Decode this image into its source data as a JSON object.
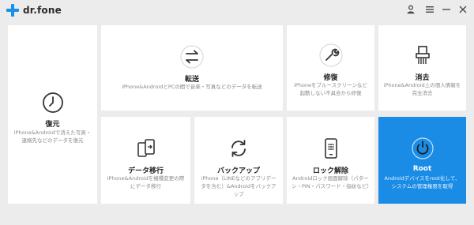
{
  "app": {
    "name": "dr.fone",
    "brand_color": "#1890e8"
  },
  "titlebar": {
    "icons": [
      "user-icon",
      "menu-icon",
      "minimize-icon",
      "close-icon"
    ]
  },
  "tools": {
    "recover": {
      "title": "復元",
      "desc": "iPhone&Androidで消えた写真・連絡先などのデータを復元",
      "icon": "clock-icon"
    },
    "transfer": {
      "title": "転送",
      "desc": "iPhone&AndroidとPCの間で音楽・写真などのデータを転送",
      "icon": "transfer-arrows-icon"
    },
    "repair": {
      "title": "修復",
      "desc": "iPhoneをブルースクリーンなど起動しない不具合から修復",
      "icon": "wrench-icon"
    },
    "erase": {
      "title": "消去",
      "desc": "iPhone&Android上の個人情報を完全消去",
      "icon": "shredder-icon"
    },
    "migrate": {
      "title": "データ移行",
      "desc": "iPhone&Androidを機種変更の際にデータ移行",
      "icon": "phone-transfer-icon"
    },
    "backup": {
      "title": "バックアップ",
      "desc": "iPhone（LINEなどのアプリデータを含む）&Androidをバックアップ",
      "icon": "sync-icon"
    },
    "unlock": {
      "title": "ロック解除",
      "desc": "Androidロック画面解除（パターン・PIN・パスワード・指紋など）",
      "icon": "phone-lock-icon"
    },
    "root": {
      "title": "Root",
      "desc": "Androidデバイスをroot化して、システムの管理権限を取得",
      "icon": "power-icon",
      "active": true,
      "active_color": "#1a8ce6"
    }
  }
}
